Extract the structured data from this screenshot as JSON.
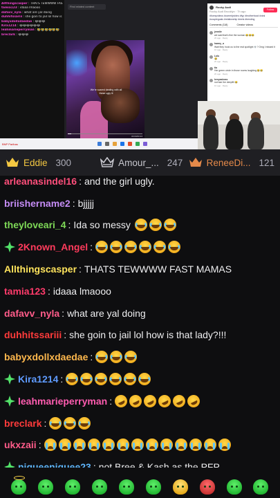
{
  "capture": {
    "chat_lines": [
      {
        "user": "Allthingscasper",
        "text": "THATS TEWWWW FAST MAMAS"
      },
      {
        "user": "tamia123",
        "text": "idaaa lmaooo"
      },
      {
        "user": "dafavv_nyla",
        "text": "what are yal doing"
      },
      {
        "user": "duhhitssariii",
        "text": "she goin to jail lol how is that lady?!!"
      },
      {
        "user": "babyxdollxdaedae",
        "text": "😂😂😂"
      },
      {
        "user": "Kira1214",
        "text": "😂😂😂😂😂😂"
      },
      {
        "user": "leahmarieperryman",
        "text": "🤣🤣🤣🤣🤣🤣"
      },
      {
        "user": "breclark",
        "text": "😂😂😂"
      }
    ],
    "address_text": "Find related content",
    "video_caption": "We're scared dealing with all these ugly lil",
    "video_time": "00:00/00:24",
    "video_progress": 0.05,
    "social": {
      "handle": "Rocky Audi",
      "sub": "Rocky Audi Brooklyn · 7h ago",
      "follow_label": "Follow",
      "description": "#funnyvideos #comedyvideo #fyp #brotherhood #viral #couplegoals #relationship #reels #trending",
      "tabs": [
        "Comments (118)",
        "Creator videos"
      ],
      "comments": [
        {
          "user": "jenniie",
          "text": "we said that's fine the woman 😂😂😂",
          "meta": "2h ago · Reply"
        },
        {
          "user": "harmy_a",
          "text": "Wait they hook us to the real spotlight 💀? Omg I missed it",
          "meta": "1h ago · Reply"
        },
        {
          "user": "Lulu",
          "text": "😂",
          "meta": "2h ago · Reply"
        },
        {
          "user": "tia",
          "text": "Her green circle in those rooms laughing 😂😂",
          "meta": "2h ago · Reply"
        },
        {
          "user": "kenyasboss",
          "text": "not bae the deepfill 😂",
          "meta": "1h ago · Reply"
        }
      ]
    },
    "taskbar_label": "BNP Paribas"
  },
  "leaderboard": [
    {
      "icon": "crown-icon",
      "name": "Eddie",
      "points": "300"
    },
    {
      "icon": "crown-outline-icon",
      "name": "Amour_...",
      "points": "247"
    },
    {
      "icon": "crown-icon",
      "name": "ReneeDi...",
      "points": "121"
    }
  ],
  "chat": [
    {
      "user": "arleanasindel16",
      "color": "#ff4f7b",
      "text": "and the girl ugly.",
      "emotes": [],
      "badge": ""
    },
    {
      "user": "briishername2",
      "color": "#c58cf5",
      "text": "bjjjjj",
      "emotes": [],
      "badge": ""
    },
    {
      "user": "theyloveari_4",
      "color": "#7ed957",
      "text": "Ida so messy",
      "emotes": [
        "laugh",
        "laugh",
        "laugh"
      ],
      "badge": ""
    },
    {
      "user": "2Known_Angel",
      "color": "#ff3b5c",
      "text": "",
      "emotes": [
        "laugh",
        "laugh",
        "laugh",
        "laugh",
        "laugh",
        "laugh"
      ],
      "badge": "diamond"
    },
    {
      "user": "Allthingscasper",
      "color": "#ffe45c",
      "text": "THATS TEWWWW FAST MAMAS",
      "emotes": [],
      "badge": ""
    },
    {
      "user": "tamia123",
      "color": "#ff3b6b",
      "text": "idaaa lmaooo",
      "emotes": [],
      "badge": ""
    },
    {
      "user": "dafavv_nyla",
      "color": "#ff5c8a",
      "text": "what are yal doing",
      "emotes": [],
      "badge": ""
    },
    {
      "user": "duhhitssariii",
      "color": "#ff3b3b",
      "text": "she goin to jail lol how is that lady?!!!",
      "emotes": [],
      "badge": ""
    },
    {
      "user": "babyxdollxdaedae",
      "color": "#ffb84d",
      "text": "",
      "emotes": [
        "laugh",
        "laugh",
        "laugh"
      ],
      "badge": ""
    },
    {
      "user": "Kira1214",
      "color": "#5f9bff",
      "text": "",
      "emotes": [
        "laugh",
        "laugh",
        "laugh",
        "laugh",
        "laugh",
        "laugh"
      ],
      "badge": "diamond"
    },
    {
      "user": "leahmarieperryman",
      "color": "#ff5cb0",
      "text": "",
      "emotes": [
        "roll",
        "roll",
        "roll",
        "roll",
        "roll",
        "roll"
      ],
      "badge": "diamond"
    },
    {
      "user": "breclark",
      "color": "#ff3b3b",
      "text": "",
      "emotes": [
        "laugh",
        "laugh",
        "laugh"
      ],
      "badge": ""
    },
    {
      "user": "ukxzaii",
      "color": "#ff5c8a",
      "text": "",
      "emotes": [
        "cry",
        "cry",
        "cry",
        "cry",
        "cry",
        "cry",
        "cry",
        "cry",
        "cry",
        "cry",
        "cry",
        "cry",
        "cry"
      ],
      "badge": ""
    },
    {
      "user": "niqueeniquee23",
      "color": "#5fb7ff",
      "text": "not Bree & Kash as the PFP",
      "emotes": [],
      "badge": "diamond"
    }
  ],
  "emote_bar": [
    "halo-blob-icon",
    "angry-blob-icon",
    "grin-blob-icon",
    "shy-blob-icon",
    "hug-blob-icon",
    "tiny-blob-icon",
    "cool-blob-icon",
    "heart-blob-icon",
    "wink-blob-icon",
    "smile-blob-icon"
  ],
  "colors": {
    "accent_gold": "#f5c842",
    "badge_green": "#53e36a",
    "background": "#0e0e10"
  }
}
